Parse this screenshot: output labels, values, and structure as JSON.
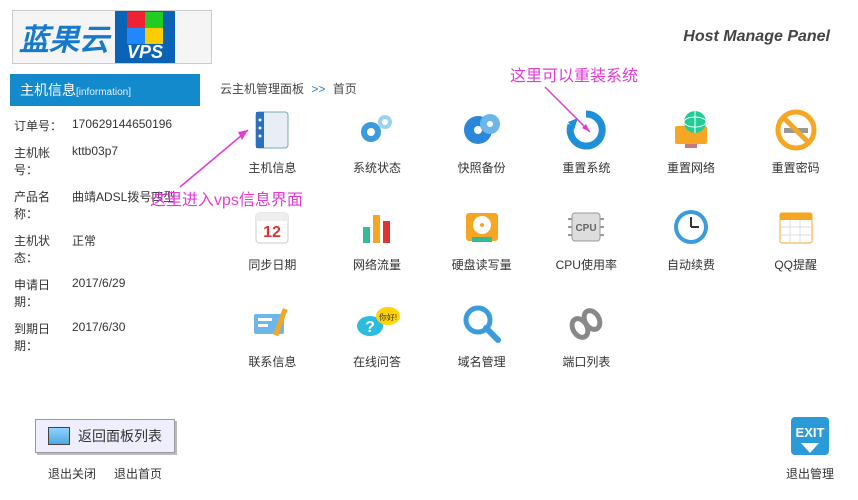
{
  "header": {
    "logo_text": "蓝果云",
    "vps_label": "VPS",
    "panel_title": "Host Manage Panel"
  },
  "sidebar": {
    "title": "主机信息",
    "title_sub": "[information]",
    "rows": [
      {
        "label": "订单号：",
        "value": "170629144650196"
      },
      {
        "label": "主机帐号：",
        "value": "kttb03p7"
      },
      {
        "label": "产品名称：",
        "value": "曲靖ADSL拨号四型"
      },
      {
        "label": "主机状态：",
        "value": "正常"
      },
      {
        "label": "申请日期：",
        "value": "2017/6/29"
      },
      {
        "label": "到期日期：",
        "value": "2017/6/30"
      }
    ],
    "return_button": "返回面板列表",
    "links": {
      "close": "退出关闭",
      "home": "退出首页"
    }
  },
  "breadcrumb": {
    "root": "云主机管理面板",
    "sep": ">>",
    "leaf": "首页"
  },
  "annotations": {
    "reinstall": "这里可以重装系统",
    "vpsinfo": "这里进入vps信息界面"
  },
  "grid": {
    "row1": [
      {
        "id": "host-info",
        "label": "主机信息"
      },
      {
        "id": "system-status",
        "label": "系统状态"
      },
      {
        "id": "backup",
        "label": "快照备份"
      },
      {
        "id": "reset-system",
        "label": "重置系统"
      },
      {
        "id": "reset-network",
        "label": "重置网络"
      },
      {
        "id": "reset-password",
        "label": "重置密码"
      }
    ],
    "row2": [
      {
        "id": "sync-date",
        "label": "同步日期",
        "date": "12"
      },
      {
        "id": "net-traffic",
        "label": "网络流量"
      },
      {
        "id": "disk-io",
        "label": "硬盘读写量"
      },
      {
        "id": "cpu-usage",
        "label": "CPU使用率",
        "chip": "CPU"
      },
      {
        "id": "auto-renew",
        "label": "自动续费"
      },
      {
        "id": "qq-remind",
        "label": "QQ提醒"
      }
    ],
    "row3": [
      {
        "id": "contact",
        "label": "联系信息"
      },
      {
        "id": "online-qa",
        "label": "在线问答",
        "bubble": "你好!"
      },
      {
        "id": "domain-mgmt",
        "label": "域名管理"
      },
      {
        "id": "port-list",
        "label": "端口列表"
      }
    ]
  },
  "exit": {
    "label": "退出管理",
    "text": "EXIT"
  }
}
